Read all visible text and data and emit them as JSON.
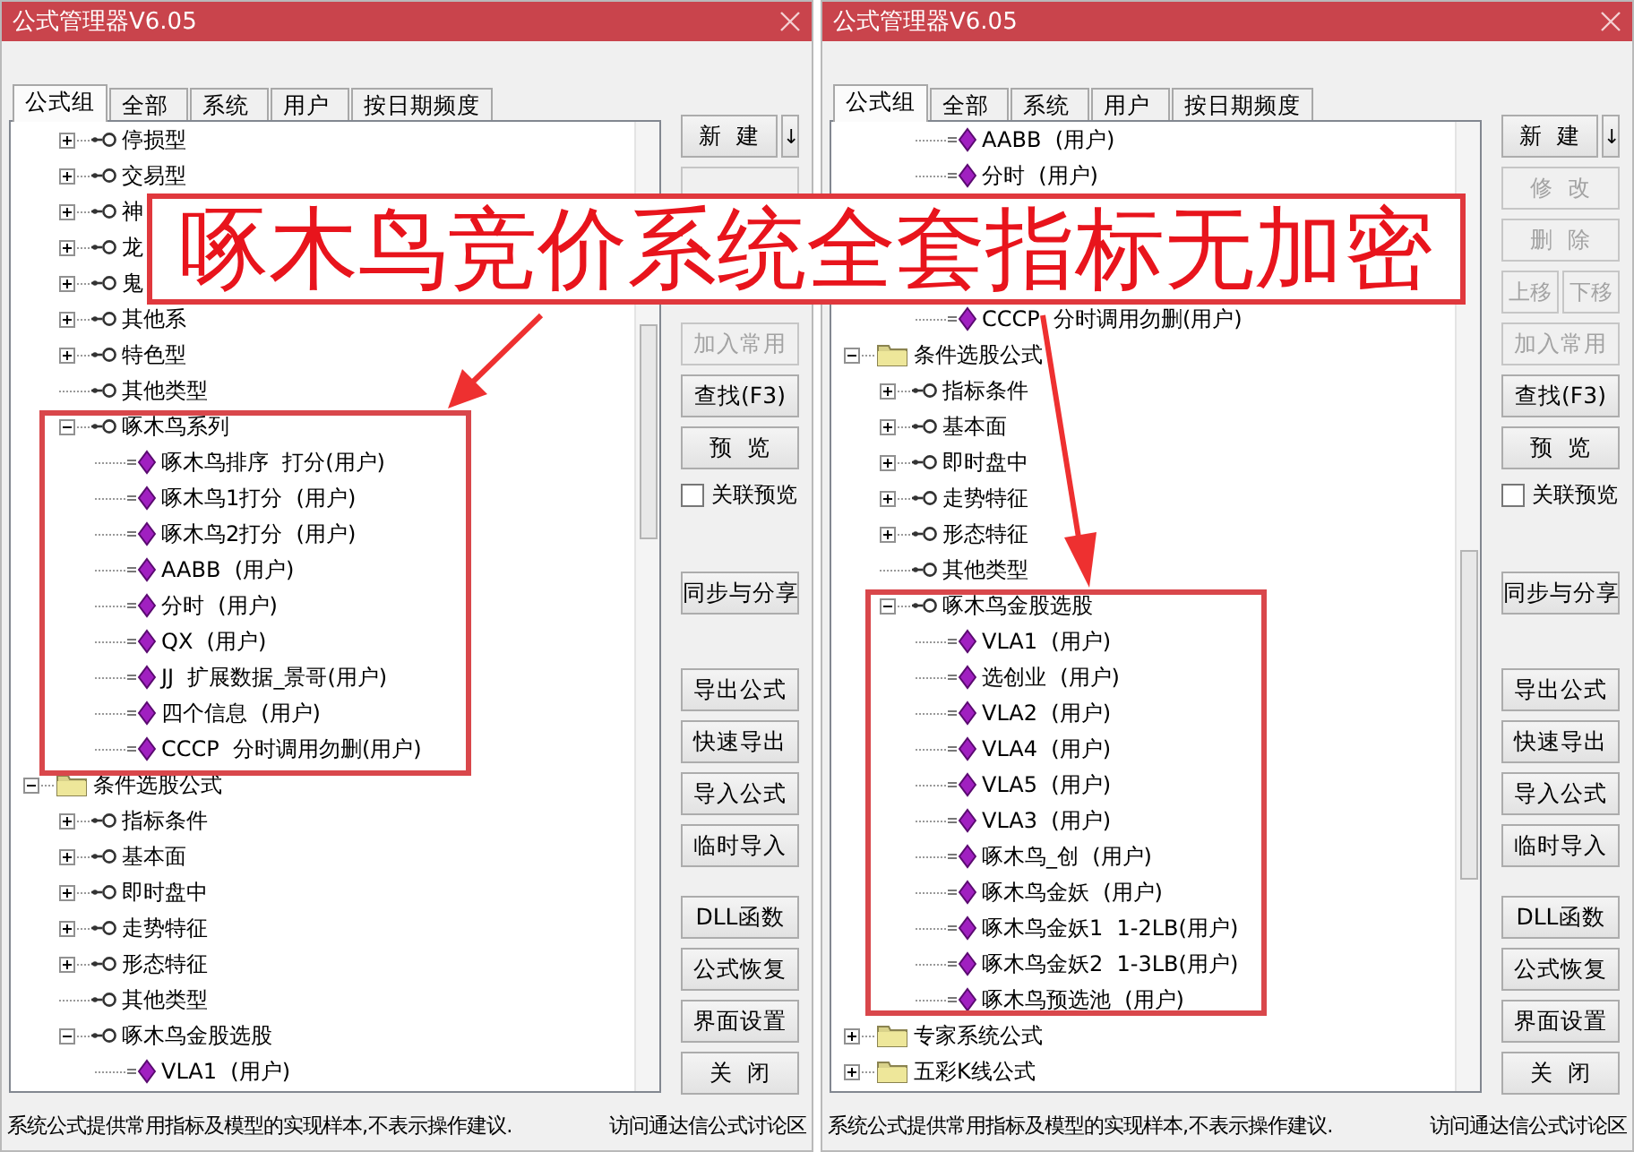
{
  "windows": [
    {
      "title": "公式管理器V6.05",
      "tabs": [
        {
          "label": "公式组",
          "selected": true
        },
        {
          "label": "全部",
          "selected": false
        },
        {
          "label": "系统",
          "selected": false
        },
        {
          "label": "用户",
          "selected": false
        },
        {
          "label": "按日期频度",
          "selected": false
        }
      ],
      "tree": [
        {
          "children": [
            {
              "kind": "group",
              "label": "停损型",
              "expanded": false
            },
            {
              "kind": "group",
              "label": "交易型",
              "expanded": false
            },
            {
              "kind": "group",
              "label": "神",
              "expanded": false
            },
            {
              "kind": "group",
              "label": "龙",
              "expanded": false
            },
            {
              "kind": "group",
              "label": "鬼",
              "expanded": false
            },
            {
              "kind": "group",
              "label": "其他系",
              "expanded": false
            },
            {
              "kind": "group",
              "label": "特色型",
              "expanded": false
            },
            {
              "kind": "group",
              "label": "其他类型"
            },
            {
              "kind": "group",
              "label": "啄木鸟系列",
              "expanded": true,
              "children": [
                {
                  "kind": "formula",
                  "label": "啄木鸟排序  打分(用户)"
                },
                {
                  "kind": "formula",
                  "label": "啄木鸟1打分  (用户)"
                },
                {
                  "kind": "formula",
                  "label": "啄木鸟2打分  (用户)"
                },
                {
                  "kind": "formula",
                  "label": "AABB  (用户)"
                },
                {
                  "kind": "formula",
                  "label": "分时  (用户)"
                },
                {
                  "kind": "formula",
                  "label": "QX  (用户)"
                },
                {
                  "kind": "formula",
                  "label": "JJ  扩展数据_景哥(用户)"
                },
                {
                  "kind": "formula",
                  "label": "四个信息  (用户)"
                },
                {
                  "kind": "formula",
                  "label": "CCCP  分时调用勿删(用户)"
                }
              ]
            }
          ]
        },
        {
          "kind": "folder",
          "label": "条件选股公式",
          "expanded": true,
          "children": [
            {
              "kind": "group",
              "label": "指标条件",
              "expanded": false
            },
            {
              "kind": "group",
              "label": "基本面",
              "expanded": false
            },
            {
              "kind": "group",
              "label": "即时盘中",
              "expanded": false
            },
            {
              "kind": "group",
              "label": "走势特征",
              "expanded": false
            },
            {
              "kind": "group",
              "label": "形态特征",
              "expanded": false
            },
            {
              "kind": "group",
              "label": "其他类型"
            },
            {
              "kind": "group",
              "label": "啄木鸟金股选股",
              "expanded": true,
              "children": [
                {
                  "kind": "formula",
                  "label": "VLA1  (用户)"
                }
              ]
            }
          ]
        }
      ],
      "buttons": [
        [
          {
            "kind": "split",
            "label": "新  建",
            "menu": "↓",
            "disabled": false
          },
          {
            "kind": "stub",
            "disabled": true
          },
          {
            "kind": "spacer"
          },
          {
            "kind": "button",
            "label": "加入常用",
            "disabled": true
          },
          {
            "kind": "button",
            "label": "查找(F3)",
            "disabled": false
          },
          {
            "kind": "button",
            "label": "预  览",
            "disabled": false
          },
          {
            "kind": "checkbox",
            "label": "关联预览",
            "checked": false
          }
        ],
        [
          {
            "kind": "button",
            "label": "同步与分享",
            "disabled": false
          }
        ],
        [
          {
            "kind": "button",
            "label": "导出公式",
            "disabled": false
          },
          {
            "kind": "button",
            "label": "快速导出",
            "disabled": false
          },
          {
            "kind": "button",
            "label": "导入公式",
            "disabled": false
          },
          {
            "kind": "button",
            "label": "临时导入",
            "disabled": false
          }
        ],
        [
          {
            "kind": "button",
            "label": "DLL函数",
            "disabled": false
          },
          {
            "kind": "button",
            "label": "公式恢复",
            "disabled": false
          },
          {
            "kind": "button",
            "label": "界面设置",
            "disabled": false
          },
          {
            "kind": "button",
            "label": "关  闭",
            "disabled": false
          }
        ]
      ],
      "status": {
        "note": "系统公式提供常用指标及模型的实现样本,不表示操作建议.",
        "link": "访问通达信公式讨论区"
      }
    },
    {
      "title": "公式管理器V6.05",
      "tabs": [
        {
          "label": "公式组",
          "selected": true
        },
        {
          "label": "全部",
          "selected": false
        },
        {
          "label": "系统",
          "selected": false
        },
        {
          "label": "用户",
          "selected": false
        },
        {
          "label": "按日期频度",
          "selected": false
        }
      ],
      "tree": [
        {
          "children": [
            {
              "children": [
                {
                  "kind": "formula",
                  "label": "AABB  (用户)"
                },
                {
                  "kind": "formula",
                  "label": "分时  (用户)"
                },
                {
                  "kind": "covered"
                },
                {
                  "kind": "covered"
                },
                {
                  "kind": "covered"
                },
                {
                  "kind": "formula",
                  "label": "CCCP  分时调用勿删(用户)"
                }
              ]
            }
          ]
        },
        {
          "kind": "folder",
          "label": "条件选股公式",
          "expanded": true,
          "children": [
            {
              "kind": "group",
              "label": "指标条件",
              "expanded": false
            },
            {
              "kind": "group",
              "label": "基本面",
              "expanded": false
            },
            {
              "kind": "group",
              "label": "即时盘中",
              "expanded": false
            },
            {
              "kind": "group",
              "label": "走势特征",
              "expanded": false
            },
            {
              "kind": "group",
              "label": "形态特征",
              "expanded": false
            },
            {
              "kind": "group",
              "label": "其他类型"
            },
            {
              "kind": "group",
              "label": "啄木鸟金股选股",
              "expanded": true,
              "children": [
                {
                  "kind": "formula",
                  "label": "VLA1  (用户)"
                },
                {
                  "kind": "formula",
                  "label": "选创业  (用户)"
                },
                {
                  "kind": "formula",
                  "label": "VLA2  (用户)"
                },
                {
                  "kind": "formula",
                  "label": "VLA4  (用户)"
                },
                {
                  "kind": "formula",
                  "label": "VLA5  (用户)"
                },
                {
                  "kind": "formula",
                  "label": "VLA3  (用户)"
                },
                {
                  "kind": "formula",
                  "label": "啄木鸟_创  (用户)"
                },
                {
                  "kind": "formula",
                  "label": "啄木鸟金妖  (用户)"
                },
                {
                  "kind": "formula",
                  "label": "啄木鸟金妖1  1-2LB(用户)"
                },
                {
                  "kind": "formula",
                  "label": "啄木鸟金妖2  1-3LB(用户)"
                },
                {
                  "kind": "formula",
                  "label": "啄木鸟预选池  (用户)"
                }
              ]
            }
          ]
        },
        {
          "kind": "folder",
          "label": "专家系统公式",
          "expanded": false
        },
        {
          "kind": "folder",
          "label": "五彩K线公式",
          "expanded": false
        }
      ],
      "buttons": [
        [
          {
            "kind": "split",
            "label": "新  建",
            "menu": "↓",
            "disabled": false
          },
          {
            "kind": "button",
            "label": "修  改",
            "disabled": true
          },
          {
            "kind": "button",
            "label": "删  除",
            "disabled": true
          },
          {
            "kind": "pair",
            "items": [
              {
                "label": "上移",
                "disabled": true
              },
              {
                "label": "下移",
                "disabled": true
              }
            ]
          },
          {
            "kind": "button",
            "label": "加入常用",
            "disabled": true
          },
          {
            "kind": "button",
            "label": "查找(F3)",
            "disabled": false
          },
          {
            "kind": "button",
            "label": "预  览",
            "disabled": false
          },
          {
            "kind": "checkbox",
            "label": "关联预览",
            "checked": false
          }
        ],
        [
          {
            "kind": "button",
            "label": "同步与分享",
            "disabled": false
          }
        ],
        [
          {
            "kind": "button",
            "label": "导出公式",
            "disabled": false
          },
          {
            "kind": "button",
            "label": "快速导出",
            "disabled": false
          },
          {
            "kind": "button",
            "label": "导入公式",
            "disabled": false
          },
          {
            "kind": "button",
            "label": "临时导入",
            "disabled": false
          }
        ],
        [
          {
            "kind": "button",
            "label": "DLL函数",
            "disabled": false
          },
          {
            "kind": "button",
            "label": "公式恢复",
            "disabled": false
          },
          {
            "kind": "button",
            "label": "界面设置",
            "disabled": false
          },
          {
            "kind": "button",
            "label": "关  闭",
            "disabled": false
          }
        ]
      ],
      "status": {
        "note": "系统公式提供常用指标及模型的实现样本,不表示操作建议.",
        "link": "访问通达信公式讨论区"
      }
    }
  ],
  "annotation": {
    "banner": "啄木鸟竞价系统全套指标无加密"
  }
}
